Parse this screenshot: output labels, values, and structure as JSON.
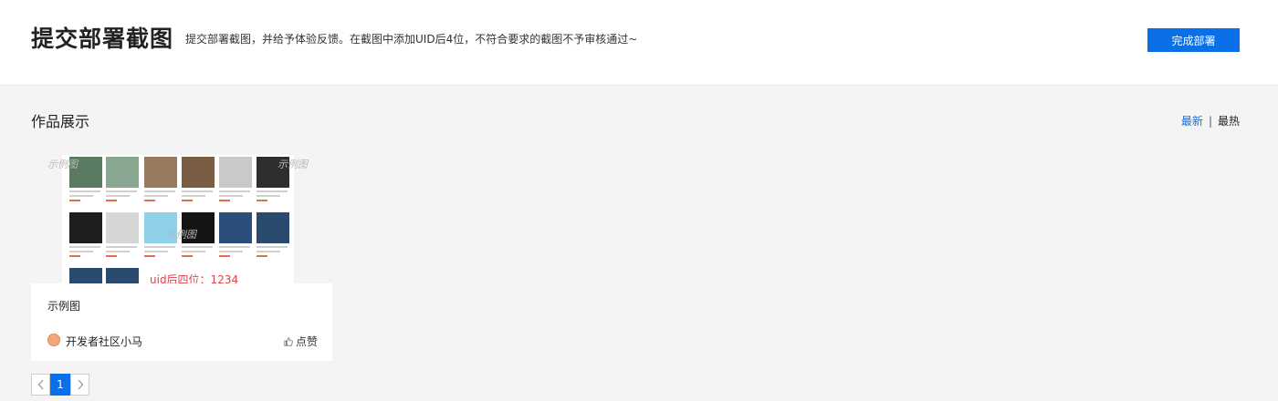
{
  "header": {
    "title": "提交部署截图",
    "description": "提交部署截图，并给予体验反馈。在截图中添加UID后4位，不符合要求的截图不予审核通过~",
    "submit_label": "完成部署"
  },
  "section": {
    "title": "作品展示",
    "sort_latest": "最新",
    "sort_separator": "|",
    "sort_hot": "最热"
  },
  "card": {
    "watermark": "示例图",
    "uid_text": "uid后四位：1234",
    "title": "示例图",
    "author": "开发者社区小马",
    "like_label": "点赞"
  },
  "pagination": {
    "current": "1"
  },
  "colors": {
    "accent": "#0b6fe8",
    "uid_red": "#e0434a"
  }
}
